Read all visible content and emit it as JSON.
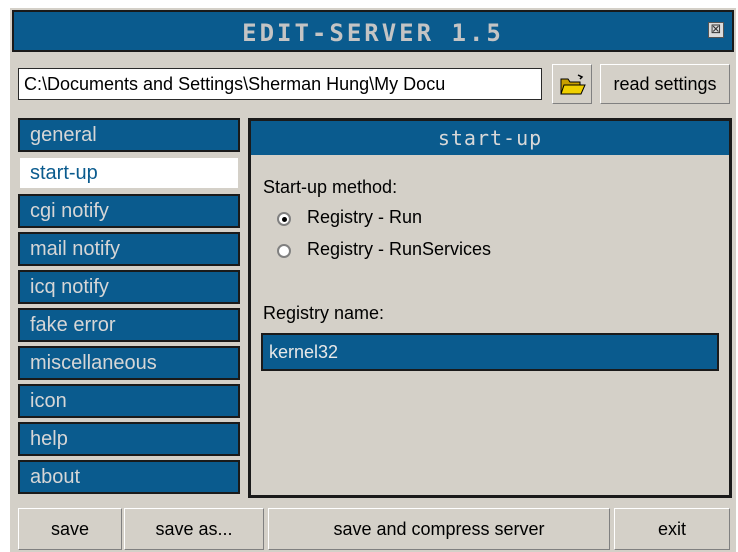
{
  "window": {
    "title": "EDIT-SERVER 1.5",
    "close_glyph": "⊠"
  },
  "path_bar": {
    "path_value": "C:\\Documents and Settings\\Sherman Hung\\My Docu",
    "open_icon": "folder-open-icon",
    "read_settings_label": "read settings"
  },
  "sidebar": {
    "items": [
      {
        "label": "general"
      },
      {
        "label": "start-up"
      },
      {
        "label": "cgi notify"
      },
      {
        "label": "mail notify"
      },
      {
        "label": "icq notify"
      },
      {
        "label": "fake error"
      },
      {
        "label": "miscellaneous"
      },
      {
        "label": "icon"
      },
      {
        "label": "help"
      },
      {
        "label": "about"
      }
    ],
    "active": "start-up"
  },
  "panel": {
    "header": "start-up",
    "method_label": "Start-up method:",
    "options": [
      {
        "label": "Registry - Run",
        "selected": true
      },
      {
        "label": "Registry - RunServices",
        "selected": false
      }
    ],
    "registry_name_label": "Registry name:",
    "registry_name_value": "kernel32"
  },
  "buttons": {
    "save": "save",
    "save_as": "save as...",
    "save_compress": "save and compress server",
    "exit": "exit"
  },
  "colors": {
    "accent": "#0a5b8e",
    "face": "#d4d0c8"
  }
}
